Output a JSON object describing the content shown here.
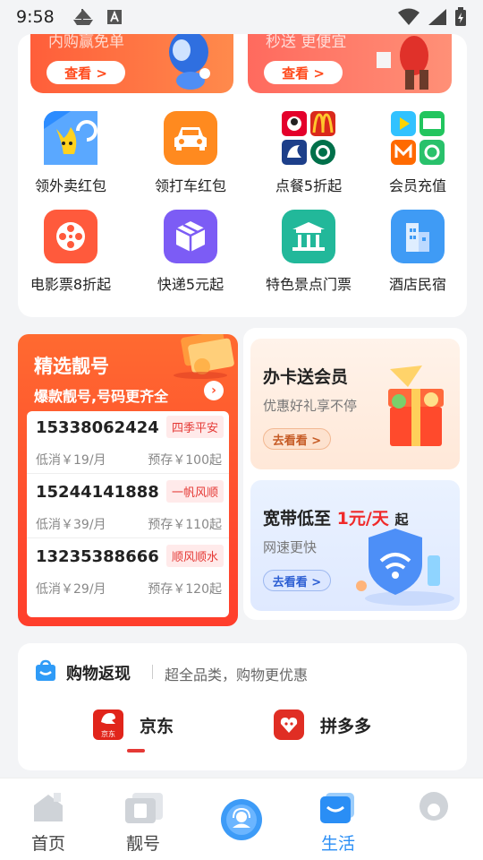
{
  "status_bar": {
    "time": "9:58"
  },
  "promos": [
    {
      "title": "内购赢免单",
      "button": "查看 >"
    },
    {
      "title": "秒送 更便宜",
      "button": "查看 >"
    }
  ],
  "services": [
    {
      "label": "领外卖红包",
      "icon": "takeout-icon"
    },
    {
      "label": "领打车红包",
      "icon": "car-icon"
    },
    {
      "label": "点餐5折起",
      "icon": "food-brands-icon"
    },
    {
      "label": "会员充值",
      "icon": "video-vip-icon"
    },
    {
      "label": "电影票8折起",
      "icon": "film-reel-icon"
    },
    {
      "label": "快递5元起",
      "icon": "package-icon"
    },
    {
      "label": "特色景点门票",
      "icon": "temple-icon"
    },
    {
      "label": "酒店民宿",
      "icon": "hotel-icon"
    }
  ],
  "numbers": {
    "title": "精选靓号",
    "subtitle": "爆款靓号,号码更齐全",
    "items": [
      {
        "phone": "15338062424",
        "tag": "四季平安",
        "fee": "低消￥19/月",
        "deposit": "预存￥100起"
      },
      {
        "phone": "15244141888",
        "tag": "一帆风顺",
        "fee": "低消￥39/月",
        "deposit": "预存￥110起"
      },
      {
        "phone": "13235388666",
        "tag": "顺风顺水",
        "fee": "低消￥29/月",
        "deposit": "预存￥120起"
      }
    ]
  },
  "banners": {
    "card": {
      "title": "办卡送会员",
      "subtitle": "优惠好礼享不停",
      "button": "去看看 >"
    },
    "broadband": {
      "title_pre": "宽带低至",
      "title_hl": "1元/天",
      "title_post": "起",
      "subtitle": "网速更快",
      "button": "去看看 >"
    }
  },
  "shopping": {
    "title": "购物返现",
    "subtitle": "超全品类，购物更优惠",
    "tabs": [
      {
        "label": "京东",
        "icon_text": "京东"
      },
      {
        "label": "拼多多"
      }
    ]
  },
  "nav": [
    {
      "label": "首页"
    },
    {
      "label": "靓号"
    },
    {
      "label": ""
    },
    {
      "label": "生活"
    },
    {
      "label": ""
    }
  ],
  "colors": {
    "accent": "#2a8ef5",
    "brand_red": "#ff4d2e"
  }
}
